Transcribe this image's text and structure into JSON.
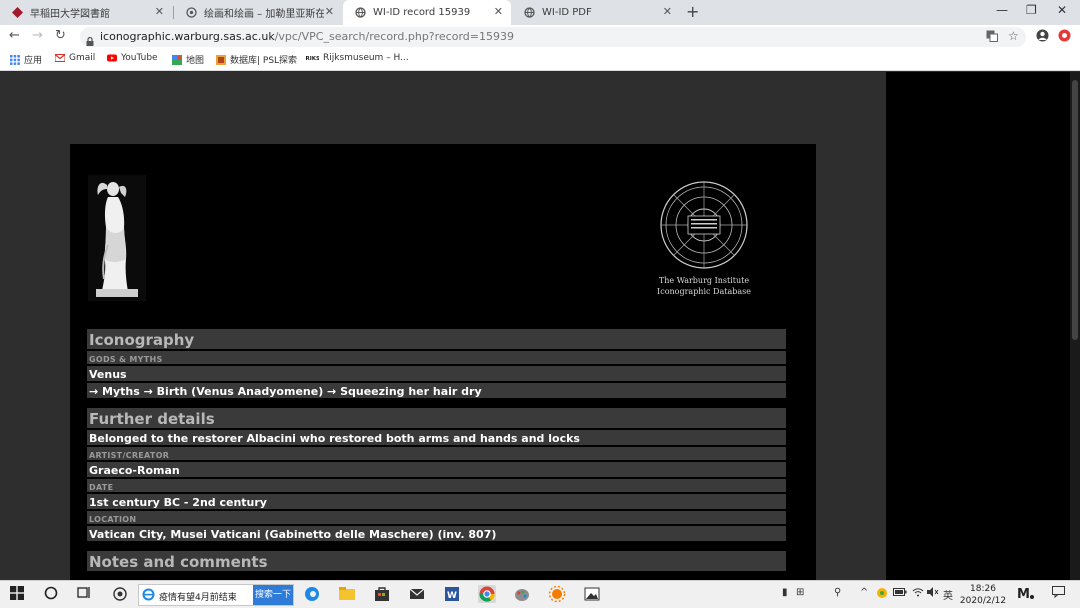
{
  "browser": {
    "tabs": [
      {
        "title": "早稲田大学図書館",
        "active": false
      },
      {
        "title": "绘画和绘画 – 加勒里亚斯在线绘!",
        "active": false
      },
      {
        "title": "WI-ID record 15939",
        "active": true
      },
      {
        "title": "WI-ID PDF",
        "active": false
      }
    ],
    "new_tab": "+",
    "url_host": "iconographic.warburg.sas.ac.uk",
    "url_path": "/vpc/VPC_search/record.php?record=15939",
    "bookmarks": [
      {
        "label": "应用",
        "icon": "apps-grid-icon"
      },
      {
        "label": "Gmail",
        "icon": "gmail-icon"
      },
      {
        "label": "YouTube",
        "icon": "youtube-icon"
      },
      {
        "label": "地图",
        "icon": "maps-icon"
      },
      {
        "label": "数据库| PSL探索",
        "icon": "psl-icon"
      },
      {
        "label": "Rijksmuseum – H...",
        "icon": "rijksmuseum-icon"
      }
    ]
  },
  "record": {
    "logo_line1": "The Warburg Institute",
    "logo_line2": "Iconographic Database",
    "sections": [
      {
        "kind": "h",
        "text": "Iconography"
      },
      {
        "kind": "l",
        "text": "GODS & MYTHS"
      },
      {
        "kind": "v",
        "text": "Venus"
      },
      {
        "kind": "v",
        "text": "→ Myths → Birth (Venus Anadyomene) → Squeezing her hair dry"
      },
      {
        "kind": "gap",
        "text": ""
      },
      {
        "kind": "h",
        "text": "Further details"
      },
      {
        "kind": "v",
        "text": "Belonged to the restorer Albacini who restored both arms and hands and locks"
      },
      {
        "kind": "l",
        "text": "ARTIST/CREATOR"
      },
      {
        "kind": "v",
        "text": "Graeco-Roman"
      },
      {
        "kind": "l",
        "text": "DATE"
      },
      {
        "kind": "v",
        "text": "1st century BC - 2nd century"
      },
      {
        "kind": "l",
        "text": "LOCATION"
      },
      {
        "kind": "v",
        "text": "Vatican City, Musei Vaticani (Gabinetto delle Maschere) (inv. 807)"
      },
      {
        "kind": "gap",
        "text": ""
      },
      {
        "kind": "h",
        "text": "Notes and comments"
      }
    ]
  },
  "taskbar": {
    "search_text": "疫情有望4月前结束",
    "search_button": "搜索一下",
    "ime": "英",
    "time": "18:26",
    "date": "2020/2/12"
  },
  "colors": {
    "page_bg": "#2e2e2e",
    "record_bg": "#000000",
    "row_bg": "#3a3a3a",
    "accent_blue": "#2f7bd8"
  }
}
